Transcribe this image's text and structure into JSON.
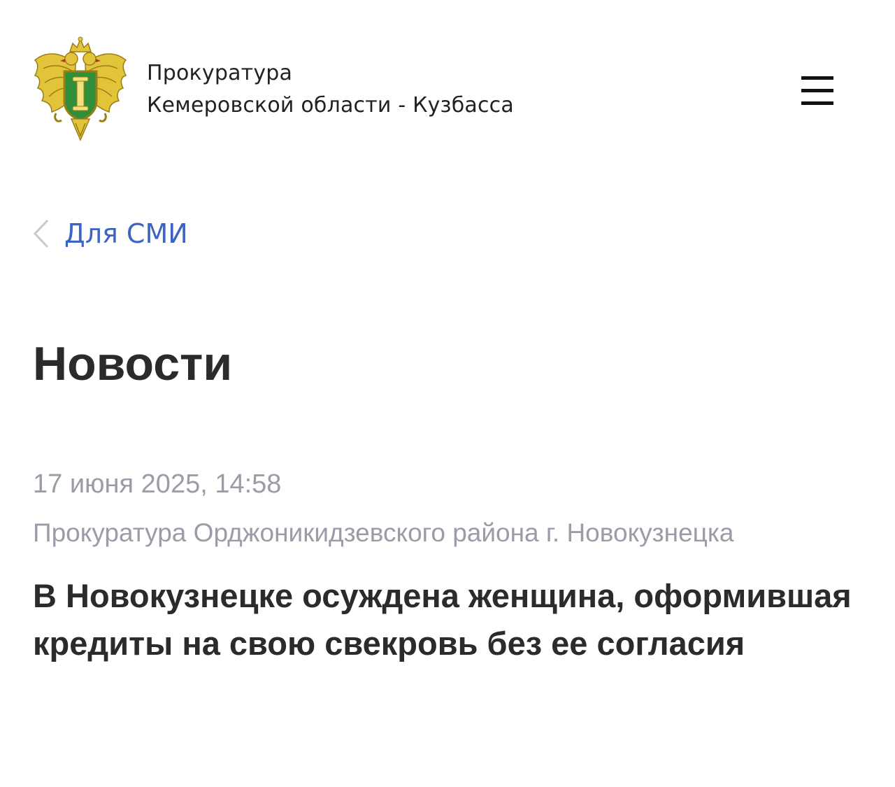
{
  "header": {
    "emblem_icon": "prosecutor-eagle-emblem-icon",
    "org_line_1": "Прокуратура",
    "org_line_2": "Кемеровской области - Кузбасса",
    "menu_icon": "hamburger-menu-icon"
  },
  "breadcrumb": {
    "back_icon": "chevron-left-icon",
    "label": "Для СМИ"
  },
  "page": {
    "title": "Новости"
  },
  "news_item": {
    "date": "17 июня 2025, 14:58",
    "source": "Прокуратура Орджоникидзевского района г. Новокузнецка",
    "headline": "В Новокузнецке осуждена женщина, оформившая кредиты на свою свекровь без ее согласия"
  },
  "colors": {
    "link": "#3b64c4",
    "meta_text": "#9a9da8",
    "title_text": "#2b2b2b",
    "emblem_gold": "#d9b92e",
    "emblem_green": "#2f8f3a"
  }
}
